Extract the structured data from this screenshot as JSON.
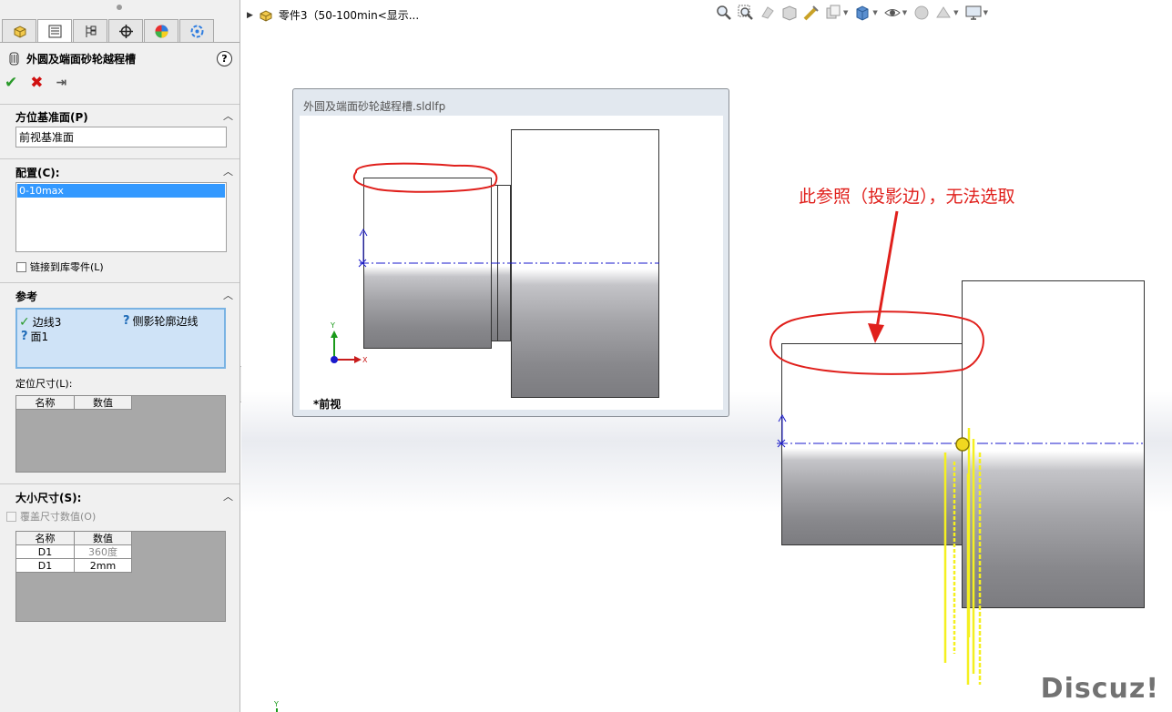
{
  "property_manager": {
    "tabs": [
      "feature-manager",
      "property-manager",
      "configuration-manager",
      "dimxpert-manager",
      "display-manager",
      "motion-manager"
    ],
    "feature_title": "外圆及端面砂轮越程槽",
    "help": "?",
    "actions": {
      "ok": "✔",
      "cancel": "✖",
      "pin": "⇥"
    },
    "orientation": {
      "heading": "方位基准面(P)",
      "value": "前视基准面"
    },
    "configuration": {
      "heading": "配置(C):",
      "selected": "0-10max",
      "link_label": "链接到库零件(L)"
    },
    "reference": {
      "heading": "参考",
      "items": [
        {
          "status": "ok",
          "label": "边线3"
        },
        {
          "status": "missing",
          "label": "面1"
        },
        {
          "status": "missing",
          "label": "侧影轮廓边线"
        }
      ]
    },
    "location_dims": {
      "heading": "定位尺寸(L):",
      "columns": [
        "名称",
        "数值"
      ],
      "rows": []
    },
    "size_dims": {
      "heading": "大小尺寸(S):",
      "override_label": "覆盖尺寸数值(O)",
      "columns": [
        "名称",
        "数值"
      ],
      "rows": [
        {
          "name": "D1",
          "value": "360度"
        },
        {
          "name": "D1",
          "value": "2mm"
        }
      ]
    }
  },
  "graphics": {
    "tree_item": "零件3（50-100min<显示...",
    "preview": {
      "title": "外圆及端面砂轮越程槽.sldlfp",
      "view_label": "*前视",
      "axis_y": "Y",
      "axis_x": "X"
    },
    "annotation": "此参照（投影边），无法选取",
    "bottom_axis_y": "Y",
    "watermark": "Discuz!"
  },
  "colors": {
    "annotation_red": "#e0201c",
    "centerline_blue": "#1a1acc",
    "selection_blue": "#cfe3f7",
    "highlight_yellow": "#f5f020"
  }
}
